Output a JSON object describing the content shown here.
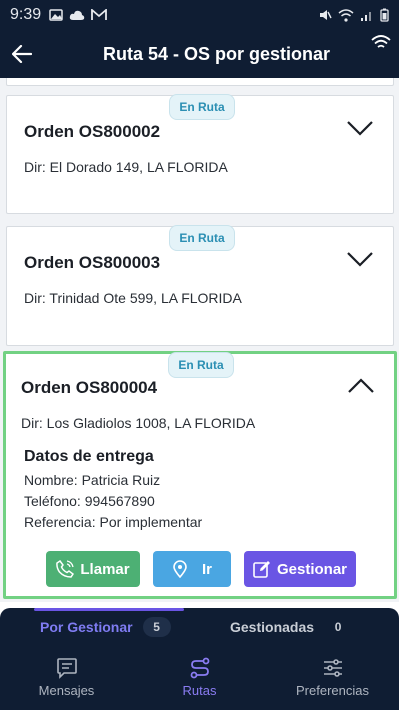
{
  "status_bar": {
    "time": "9:39"
  },
  "header": {
    "title": "Ruta 54 - OS por gestionar"
  },
  "orders": [
    {
      "badge": "En Ruta",
      "order": "Orden OS800002",
      "address": "Dir: El Dorado 149, LA FLORIDA"
    },
    {
      "badge": "En Ruta",
      "order": "Orden OS800003",
      "address": "Dir: Trinidad Ote 599, LA FLORIDA"
    },
    {
      "badge": "En Ruta",
      "order": "Orden OS800004",
      "address": "Dir: Los Gladiolos 1008, LA FLORIDA",
      "details": {
        "title": "Datos de entrega",
        "name": "Nombre: Patricia Ruiz",
        "phone": "Teléfono: 994567890",
        "reference": "Referencia: Por implementar"
      },
      "actions": {
        "call": "Llamar",
        "go": "Ir",
        "manage": "Gestionar"
      }
    }
  ],
  "segments": [
    {
      "label": "Por Gestionar",
      "count": "5"
    },
    {
      "label": "Gestionadas",
      "count": "0"
    }
  ],
  "nav": [
    {
      "label": "Mensajes"
    },
    {
      "label": "Rutas"
    },
    {
      "label": "Preferencias"
    }
  ],
  "colors": {
    "header_bg": "#0f1d33",
    "selected_border": "#72d183",
    "call": "#4db074",
    "go": "#4aa6e2",
    "manage": "#6a55e4",
    "active_tab": "#7f7cf2"
  }
}
